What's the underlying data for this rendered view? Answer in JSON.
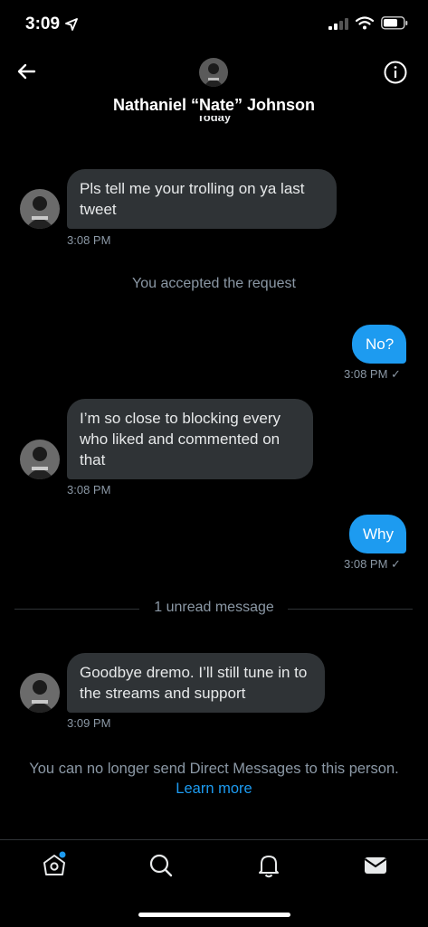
{
  "status": {
    "time": "3:09"
  },
  "header": {
    "name": "Nathaniel “Nate” Johnson",
    "date_label": "Today"
  },
  "messages": [
    {
      "text": "Pls tell me your trolling on ya last tweet",
      "time": "3:08 PM"
    },
    {
      "text": "No?",
      "time": "3:08 PM"
    },
    {
      "text": "I’m so close to blocking every who liked and commented on that",
      "time": "3:08 PM"
    },
    {
      "text": "Why",
      "time": "3:08 PM"
    },
    {
      "text": "Goodbye dremo. I’ll still tune in to the streams and support",
      "time": "3:09 PM"
    }
  ],
  "system": {
    "accepted": "You accepted the request",
    "unread": "1 unread message",
    "blocked_notice": "You can no longer send Direct Messages to this person.",
    "learn_more": "Learn more"
  },
  "sent_check": "✓",
  "colors": {
    "accent": "#1d9bf0",
    "bubble_in": "#2f3336",
    "background": "#000000"
  },
  "tabs": [
    "home-icon",
    "search-icon",
    "notifications-icon",
    "messages-icon"
  ]
}
